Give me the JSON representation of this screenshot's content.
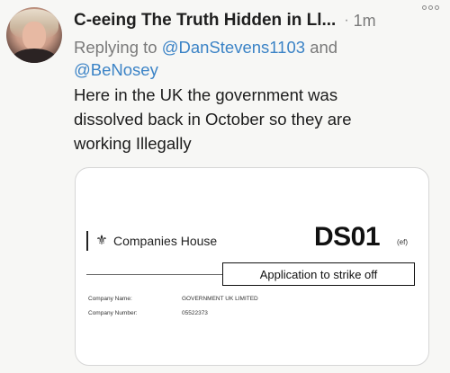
{
  "tweet": {
    "author_name": "C-eeing The Truth Hidden in Ll...",
    "separator": "·",
    "timestamp": "1m",
    "more_icon": "more-options-icon",
    "reply_prefix": "Replying to",
    "reply_mention_1": "@DanStevens1103",
    "reply_and": "and",
    "reply_mention_2": "@BeNosey",
    "text_line_1": "Here in the UK the government was",
    "text_line_2": "dissolved back in October so they are",
    "text_line_3": "working Illegally"
  },
  "form_image": {
    "org_name": "Companies House",
    "form_code": "DS01",
    "form_code_suffix": "(ef)",
    "title": "Application to strike off",
    "fields": [
      {
        "label": "Company Name:",
        "value": "GOVERNMENT UK LIMITED"
      },
      {
        "label": "Company Number:",
        "value": "05522373"
      }
    ]
  },
  "colors": {
    "background": "#f7f7f5",
    "mention": "#3b83c6",
    "muted": "#7a7a7a"
  }
}
